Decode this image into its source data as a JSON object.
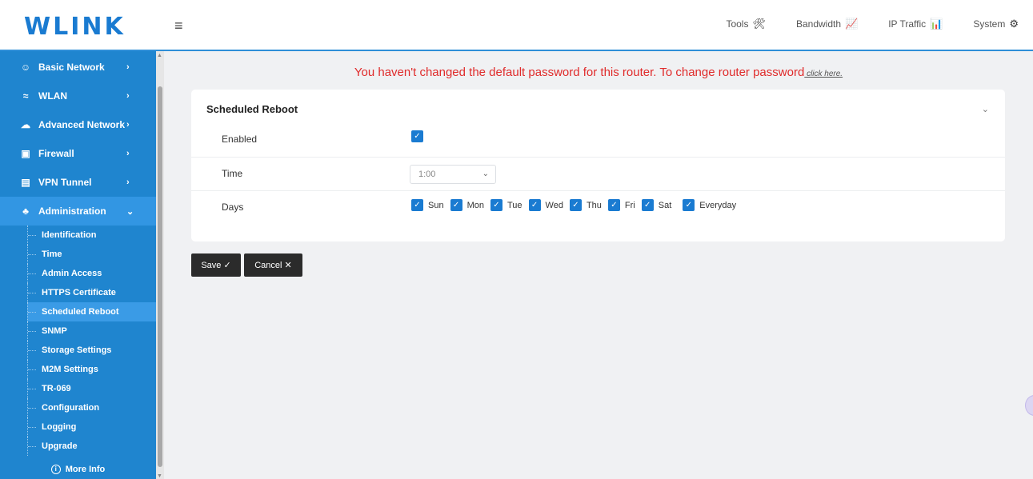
{
  "brand": {
    "logo": "WLINK",
    "menu_icon": "≡"
  },
  "topnav": [
    {
      "label": "Tools",
      "icon": "🛠"
    },
    {
      "label": "Bandwidth",
      "icon": "📈"
    },
    {
      "label": "IP Traffic",
      "icon": "📊"
    },
    {
      "label": "System",
      "icon": "⚙"
    }
  ],
  "sidebar": {
    "items": [
      {
        "label": "Basic Network",
        "icon": "☺",
        "chevron": "›"
      },
      {
        "label": "WLAN",
        "icon": "≈",
        "chevron": "›"
      },
      {
        "label": "Advanced Network",
        "icon": "☁",
        "chevron": "›"
      },
      {
        "label": "Firewall",
        "icon": "▣",
        "chevron": "›"
      },
      {
        "label": "VPN Tunnel",
        "icon": "▤",
        "chevron": "›"
      },
      {
        "label": "Administration",
        "icon": "♣",
        "chevron": "⌄"
      }
    ],
    "subitems": [
      "Identification",
      "Time",
      "Admin Access",
      "HTTPS Certificate",
      "Scheduled Reboot",
      "SNMP",
      "Storage Settings",
      "M2M Settings",
      "TR-069",
      "Configuration",
      "Logging",
      "Upgrade"
    ],
    "active_subitem": "Scheduled Reboot",
    "more_info": "More Info"
  },
  "warning": {
    "text": "You haven't changed the default password for this router. To change router password",
    "link": " click here."
  },
  "card": {
    "title": "Scheduled Reboot",
    "enabled_label": "Enabled",
    "enabled": true,
    "time_label": "Time",
    "time_value": "1:00",
    "days_label": "Days",
    "days": [
      {
        "label": "Sun",
        "checked": true
      },
      {
        "label": "Mon",
        "checked": true
      },
      {
        "label": "Tue",
        "checked": true
      },
      {
        "label": "Wed",
        "checked": true
      },
      {
        "label": "Thu",
        "checked": true
      },
      {
        "label": "Fri",
        "checked": true
      },
      {
        "label": "Sat",
        "checked": true
      },
      {
        "label": "Everyday",
        "checked": true
      }
    ]
  },
  "buttons": {
    "save": "Save ✓",
    "cancel": "Cancel ✕"
  },
  "colors": {
    "accent": "#1f85cf",
    "warning": "#e02b2b",
    "button": "#2b2b2b"
  }
}
